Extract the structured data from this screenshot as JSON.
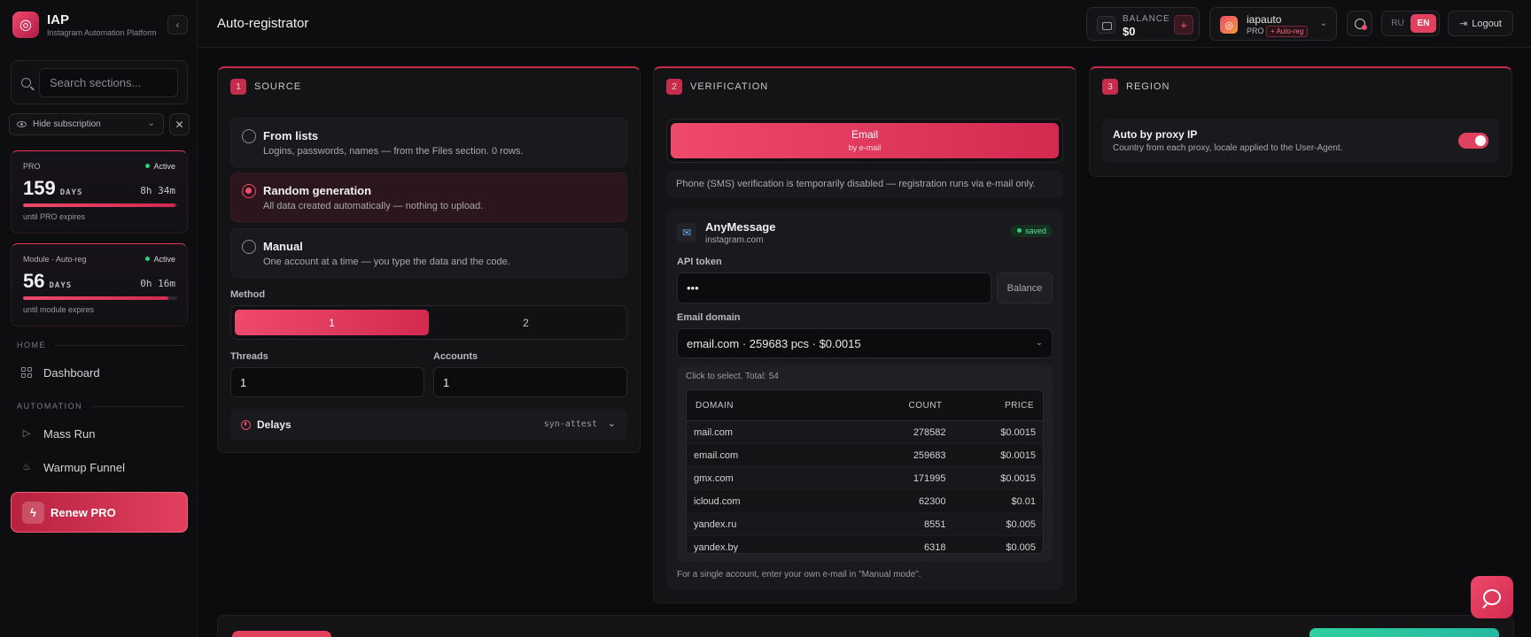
{
  "brand": {
    "name": "IAP",
    "subtitle": "Instagram Automation Platform",
    "logo_icon": "instagram-logo-icon"
  },
  "sidebar": {
    "search_placeholder": "Search sections...",
    "hide_subscription_label": "Hide subscription",
    "subscriptions": [
      {
        "tag": "PRO",
        "status": "Active",
        "days": "159",
        "unit": "DAYS",
        "time": "8h 34m",
        "progress": 0.99,
        "footer": "until PRO expires"
      },
      {
        "tag": "Module · Auto-reg",
        "status": "Active",
        "days": "56",
        "unit": "DAYS",
        "time": "0h 16m",
        "progress": 0.94,
        "footer": "until module expires"
      }
    ],
    "sections": [
      {
        "label": "HOME",
        "items": [
          {
            "label": "Dashboard",
            "icon": "grid-icon"
          }
        ]
      },
      {
        "label": "AUTOMATION",
        "items": [
          {
            "label": "Mass Run",
            "icon": "play-icon"
          },
          {
            "label": "Warmup Funnel",
            "icon": "flame-icon"
          }
        ]
      }
    ],
    "renew_label": "Renew PRO"
  },
  "topbar": {
    "title": "Auto-registrator",
    "balance_label": "BALANCE",
    "balance_value": "$0",
    "add_label": "+",
    "user": {
      "name": "iapauto",
      "tier": "PRO",
      "badge": "+ Auto-reg"
    },
    "languages": [
      "RU",
      "EN"
    ],
    "active_language": "EN",
    "logout_label": "Logout"
  },
  "source": {
    "step": "1",
    "title": "SOURCE",
    "options": [
      {
        "title": "From lists",
        "desc": "Logins, passwords, names — from the Files section. 0 rows.",
        "selected": false
      },
      {
        "title": "Random generation",
        "desc": "All data created automatically — nothing to upload.",
        "selected": true
      },
      {
        "title": "Manual",
        "desc": "One account at a time — you type the data and the code.",
        "selected": false
      }
    ],
    "method_label": "Method",
    "methods": [
      "1",
      "2"
    ],
    "threads_label": "Threads",
    "threads_value": "1",
    "accounts_label": "Accounts",
    "accounts_value": "1",
    "delays_label": "Delays",
    "delays_meta": "syn-attest"
  },
  "verification": {
    "step": "2",
    "title": "VERIFICATION",
    "email_tab": {
      "title": "Email",
      "subtitle": "by e-mail"
    },
    "sms_note": "Phone (SMS) verification is temporarily disabled — registration runs via e-mail only.",
    "provider": {
      "name": "AnyMessage",
      "site": "instagram.com",
      "badge": "saved"
    },
    "api_token_label": "API token",
    "api_token_value": "•••",
    "balance_button": "Balance",
    "email_domain_label": "Email domain",
    "email_domain_selected": "email.com · 259683 pcs · $0.0015",
    "domain_hint": "Click to select. Total: 54",
    "table_headers": [
      "DOMAIN",
      "COUNT",
      "PRICE"
    ],
    "domains": [
      {
        "domain": "mail.com",
        "count": "278582",
        "price": "$0.0015"
      },
      {
        "domain": "email.com",
        "count": "259683",
        "price": "$0.0015"
      },
      {
        "domain": "gmx.com",
        "count": "171995",
        "price": "$0.0015"
      },
      {
        "domain": "icloud.com",
        "count": "62300",
        "price": "$0.01"
      },
      {
        "domain": "yandex.ru",
        "count": "8551",
        "price": "$0.005"
      },
      {
        "domain": "yandex.by",
        "count": "6318",
        "price": "$0.005"
      }
    ],
    "single_note": "For a single account, enter your own e-mail in \"Manual mode\"."
  },
  "region": {
    "step": "3",
    "title": "REGION",
    "auto_title": "Auto by proxy IP",
    "auto_desc": "Country from each proxy, locale applied to the User-Agent.",
    "enabled": true
  },
  "colors": {
    "accent": "#e2405f",
    "success": "#2fcf7e",
    "background": "#0c0c0e"
  }
}
